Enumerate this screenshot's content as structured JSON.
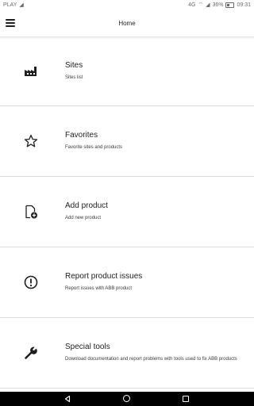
{
  "status_bar": {
    "carrier": "PLAY",
    "battery_percent": "36%",
    "time": "09:31"
  },
  "app_bar": {
    "title": "Home",
    "menu_icon": "hamburger-menu-icon"
  },
  "menu_items": [
    {
      "id": "sites",
      "icon": "factory-icon",
      "title": "Sites",
      "description": "Sites list"
    },
    {
      "id": "favorites",
      "icon": "star-icon",
      "title": "Favorites",
      "description": "Favorite sites and products"
    },
    {
      "id": "add-product",
      "icon": "add-document-icon",
      "title": "Add product",
      "description": "Add new product"
    },
    {
      "id": "report-issues",
      "icon": "alert-circle-icon",
      "title": "Report product issues",
      "description": "Report issues with ABB product"
    },
    {
      "id": "special-tools",
      "icon": "wrench-icon",
      "title": "Special tools",
      "description": "Download documentation and report problems with tools used to fix ABB products"
    }
  ],
  "nav_bar": {
    "back_icon": "back-triangle-icon",
    "home_icon": "home-circle-icon",
    "recents_icon": "recents-square-icon"
  }
}
